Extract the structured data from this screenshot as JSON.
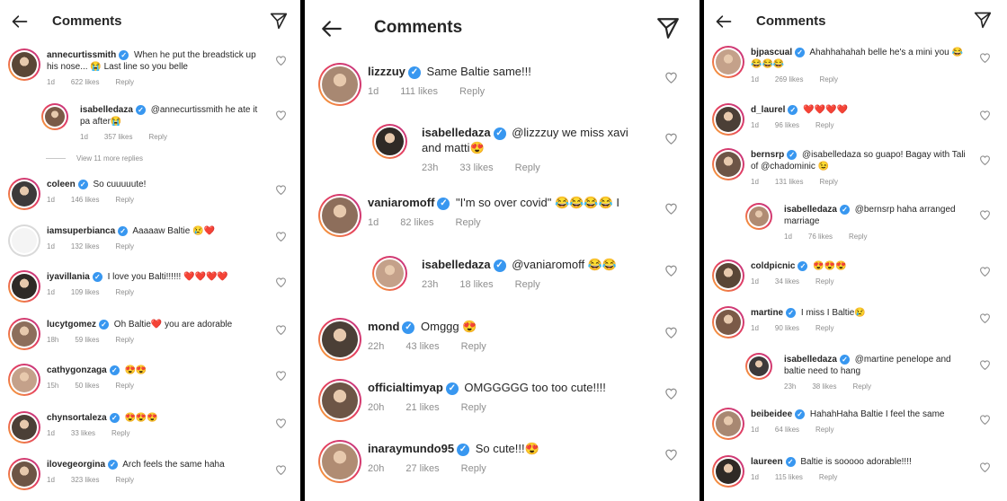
{
  "header": {
    "title": "Comments"
  },
  "labels": {
    "reply": "Reply",
    "view_more": "View 11 more replies"
  },
  "colors": {
    "verified": "#3897f0",
    "meta": "#8e8e8e",
    "heart_red": "#ed4956"
  },
  "panels": [
    {
      "comments": [
        {
          "user": "annecurtissmith",
          "text": "When he put the breadstick up his nose... 😭 Last line so you belle",
          "time": "1d",
          "likes": "622 likes"
        },
        {
          "user": "isabelledaza",
          "text": "@annecurtissmith he ate it pa after😭",
          "time": "1d",
          "likes": "357 likes"
        },
        {
          "user": "coleen",
          "text": "So cuuuuute!",
          "time": "1d",
          "likes": "146 likes"
        },
        {
          "user": "iamsuperbianca",
          "text": "Aaaaaw Baltie 😢❤️",
          "time": "1d",
          "likes": "132 likes"
        },
        {
          "user": "iyavillania",
          "text": "I love you Balti!!!!!! ❤️❤️❤️❤️",
          "time": "1d",
          "likes": "109 likes"
        },
        {
          "user": "lucytgomez",
          "text": "Oh Baltie❤️ you are adorable",
          "time": "18h",
          "likes": "59 likes"
        },
        {
          "user": "cathygonzaga",
          "text": "😍😍",
          "time": "15h",
          "likes": "50 likes"
        },
        {
          "user": "chynsortaleza",
          "text": "😍😍😍",
          "time": "1d",
          "likes": "33 likes"
        },
        {
          "user": "ilovegeorgina",
          "text": "Arch feels the same haha",
          "time": "1d",
          "likes": "323 likes"
        }
      ]
    },
    {
      "comments": [
        {
          "user": "lizzzuy",
          "text": "Same Baltie same!!!",
          "time": "1d",
          "likes": "111 likes"
        },
        {
          "user": "isabelledaza",
          "text": "@lizzzuy we miss xavi and matti😍",
          "time": "23h",
          "likes": "33 likes"
        },
        {
          "user": "vaniaromoff",
          "text": "\"I'm so over covid\" 😂😂😂😂 I",
          "time": "1d",
          "likes": "82 likes"
        },
        {
          "user": "isabelledaza",
          "text": "@vaniaromoff 😂😂",
          "time": "23h",
          "likes": "18 likes"
        },
        {
          "user": "mond",
          "text": "Omggg 😍",
          "time": "22h",
          "likes": "43 likes"
        },
        {
          "user": "officialtimyap",
          "text": "OMGGGGG too too cute!!!!",
          "time": "20h",
          "likes": "21 likes"
        },
        {
          "user": "inaraymundo95",
          "text": "So cute!!!😍",
          "time": "20h",
          "likes": "27 likes"
        }
      ]
    },
    {
      "comments": [
        {
          "user": "bjpascual",
          "text": "Ahahhahahah belle he's a mini you 😂😂😂😂",
          "time": "1d",
          "likes": "269 likes"
        },
        {
          "user": "d_laurel",
          "text": "❤️❤️❤️❤️",
          "time": "1d",
          "likes": "96 likes"
        },
        {
          "user": "bernsrp",
          "text": "@isabelledaza  so guapo! Bagay with Tali of @chadominic 😉",
          "time": "1d",
          "likes": "131 likes"
        },
        {
          "user": "isabelledaza",
          "text": "@bernsrp haha arranged marriage",
          "time": "1d",
          "likes": "76 likes"
        },
        {
          "user": "coldpicnic",
          "text": "😍😍😍",
          "time": "1d",
          "likes": "34 likes"
        },
        {
          "user": "martine",
          "text": "I miss I Baltie😢",
          "time": "1d",
          "likes": "90 likes"
        },
        {
          "user": "isabelledaza",
          "text": "@martine penelope and baltie need to hang",
          "time": "23h",
          "likes": "38 likes"
        },
        {
          "user": "beibeidee",
          "text": "HahahHaha Baltie I feel the same",
          "time": "1d",
          "likes": "64 likes"
        },
        {
          "user": "laureen",
          "text": "Baltie is sooooo adorable!!!!",
          "time": "1d",
          "likes": "115 likes"
        }
      ]
    }
  ]
}
